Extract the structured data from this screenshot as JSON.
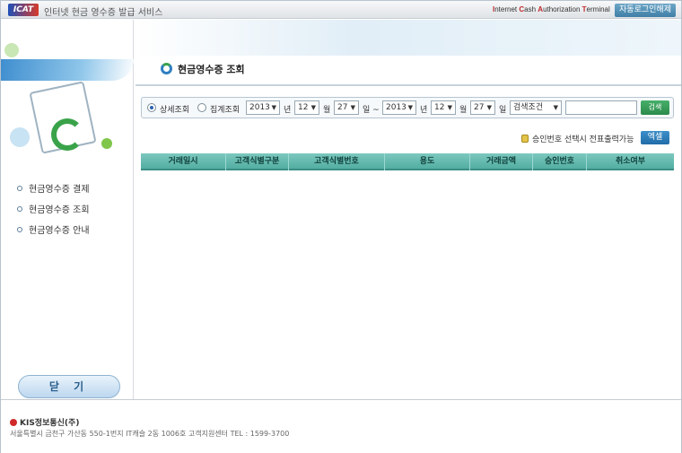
{
  "header": {
    "logo_text": "ICAT",
    "app_title": "인터넷 현금 영수증 발급 서비스",
    "term_parts": [
      {
        "text": "I",
        "red": true
      },
      {
        "text": "nternet ",
        "red": false
      },
      {
        "text": "C",
        "red": true
      },
      {
        "text": "ash ",
        "red": false
      },
      {
        "text": "A",
        "red": true
      },
      {
        "text": "uthorization ",
        "red": false
      },
      {
        "text": "T",
        "red": true
      },
      {
        "text": "erminal",
        "red": false
      }
    ],
    "logout_label": "자동로그인해제"
  },
  "sidebar": {
    "items": [
      {
        "label": "현금영수증 결제"
      },
      {
        "label": "현금영수증 조회"
      },
      {
        "label": "현금영수증 안내"
      }
    ],
    "close_label": "닫 기"
  },
  "main": {
    "page_title": "현금영수증 조회",
    "search": {
      "radio_detail": "상세조회",
      "radio_summary": "집계조회",
      "from_year": "2013",
      "from_month": "12",
      "from_day": "27",
      "to_year": "2013",
      "to_month": "12",
      "to_day": "27",
      "unit_year": "년",
      "unit_month": "월",
      "unit_day": "일 ~",
      "unit_day_end": "일",
      "condition": "검색조건",
      "button": "검색"
    },
    "note": "승인번호 선택시 전표출력가능",
    "excel_label": "엑셀",
    "columns": [
      "거래일시",
      "고객식별구분",
      "고객식별번호",
      "용도",
      "거래금액",
      "승인번호",
      "취소여부"
    ]
  },
  "footer": {
    "company": "KIS정보통신(주)",
    "address": "서울특별시 금천구 가산동 550-1번지 IT캐슬 2동 1006호 고객지원센터  TEL : 1599-3700"
  }
}
